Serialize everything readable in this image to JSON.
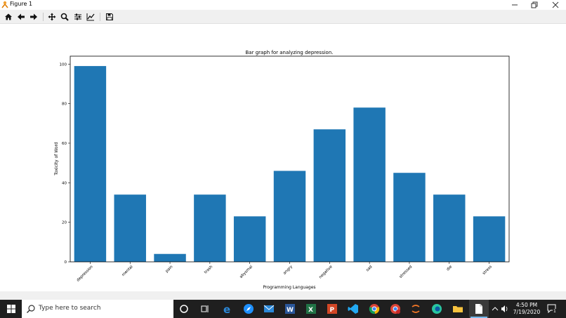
{
  "window": {
    "title": "Figure 1"
  },
  "taskbar": {
    "search_placeholder": "Type here to search",
    "time": "4:50 PM",
    "date": "7/19/2020",
    "notification_count": "1"
  },
  "colors": {
    "bar": "#1f77b4",
    "taskbar": "#1f1f1f",
    "toolbar": "#f0f0f0"
  },
  "chart_data": {
    "type": "bar",
    "title": "Bar graph for analyzing depression.",
    "xlabel": "Programming Languages",
    "ylabel": "Toxicity of Word",
    "categories": [
      "depression",
      "mental",
      "pain",
      "trash",
      "abysmal",
      "angry",
      "negative",
      "sad",
      "stressed",
      "die",
      "stress"
    ],
    "values": [
      99,
      34,
      4,
      34,
      23,
      46,
      67,
      78,
      45,
      34,
      23
    ],
    "ylim": [
      0,
      104
    ],
    "yticks": [
      0,
      20,
      40,
      60,
      80,
      100
    ],
    "grid": false,
    "xtick_rotation": 45
  }
}
